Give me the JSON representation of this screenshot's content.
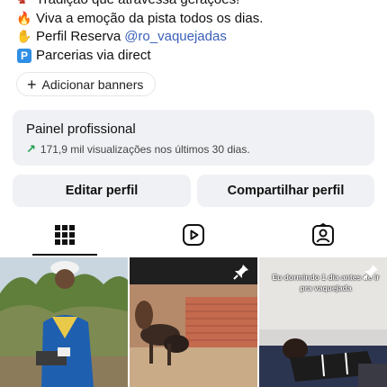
{
  "bio": {
    "line_top": "Tradição que atravessa gerações!",
    "line1": "Viva a emoção da pista todos os dias.",
    "line2_prefix": "Perfil Reserva",
    "line2_mention": "@ro_vaquejadas",
    "line3": "Parcerias via direct"
  },
  "add_banners_label": "Adicionar banners",
  "panel": {
    "title": "Painel profissional",
    "stats": "171,9 mil visualizações nos últimos 30 dias."
  },
  "buttons": {
    "edit": "Editar perfil",
    "share": "Compartilhar perfil"
  },
  "tabs": [
    "grid-icon",
    "reels-icon",
    "tagged-icon"
  ],
  "posts": [
    {
      "type": "photo",
      "pinned": false
    },
    {
      "type": "photo",
      "pinned": true
    },
    {
      "type": "photo",
      "pinned": true,
      "overlay_text": "Eu dormindo 1 dia antes de ir pra vaquejada"
    }
  ],
  "colors": {
    "mention": "#3a5fb8",
    "panel_bg": "#eff1f4",
    "trend_arrow": "#1a9c4a"
  }
}
